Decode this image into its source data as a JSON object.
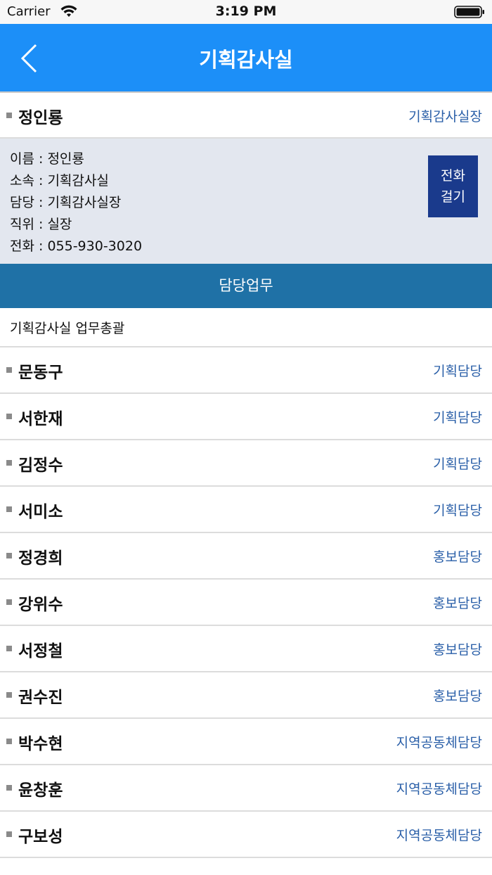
{
  "status_bar": {
    "carrier": "Carrier",
    "time": "3:19 PM"
  },
  "nav": {
    "title": "기획감사실"
  },
  "head": {
    "name": "정인룡",
    "role": "기획감사실장",
    "details": [
      "이름 : 정인룡",
      "소속 : 기획감사실",
      "담당 : 기획감사실장",
      "직위 : 실장",
      "전화 : 055-930-3020"
    ],
    "call_button": [
      "전화",
      "걸기"
    ]
  },
  "duty": {
    "header": "담당업무",
    "text": "기획감사실 업무총괄"
  },
  "staff": [
    {
      "name": "문동구",
      "role": "기획담당"
    },
    {
      "name": "서한재",
      "role": "기획담당"
    },
    {
      "name": "김정수",
      "role": "기획담당"
    },
    {
      "name": "서미소",
      "role": "기획담당"
    },
    {
      "name": "정경희",
      "role": "홍보담당"
    },
    {
      "name": "강위수",
      "role": "홍보담당"
    },
    {
      "name": "서정철",
      "role": "홍보담당"
    },
    {
      "name": "권수진",
      "role": "홍보담당"
    },
    {
      "name": "박수현",
      "role": "지역공동체담당"
    },
    {
      "name": "윤창훈",
      "role": "지역공동체담당"
    },
    {
      "name": "구보성",
      "role": "지역공동체담당"
    }
  ],
  "colors": {
    "nav": "#1c8ff8",
    "duty_header": "#1f71a6",
    "call_button": "#1a3a8c",
    "role_text": "#2a5fa8",
    "detail_bg": "#e3e7ef"
  }
}
